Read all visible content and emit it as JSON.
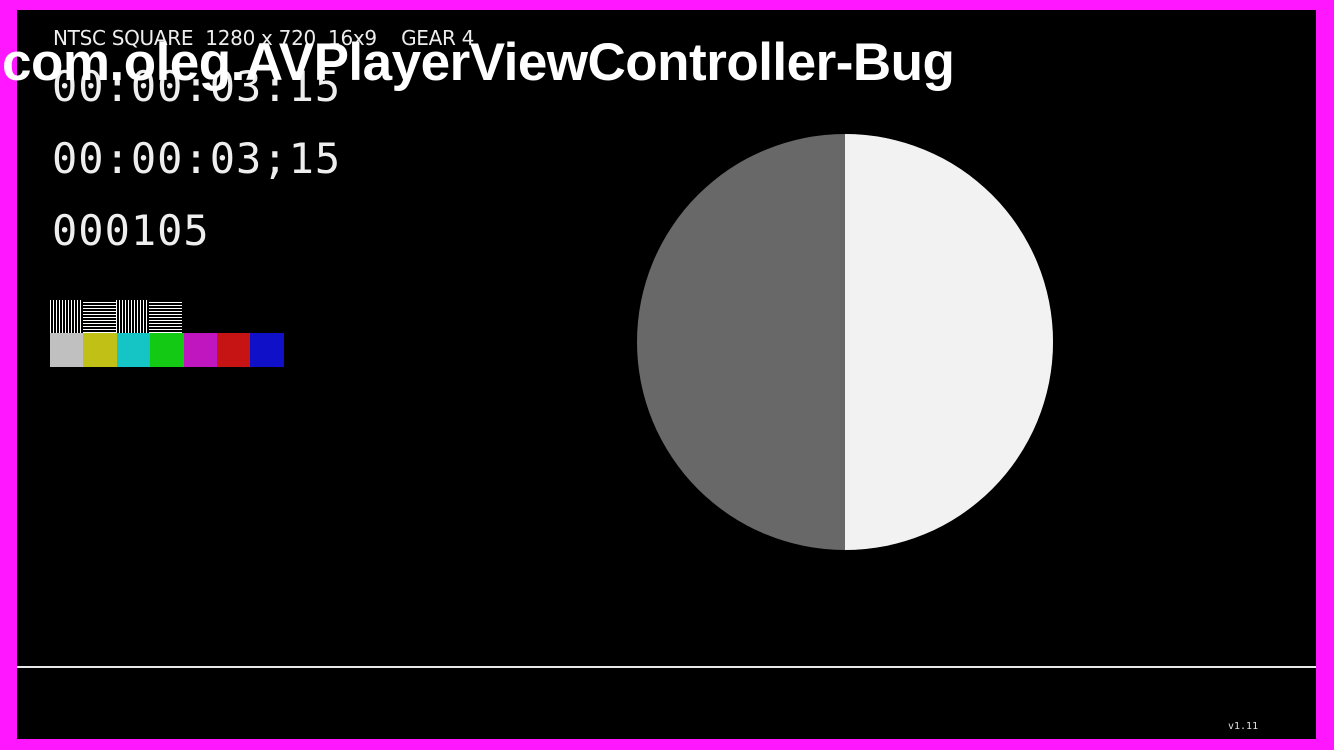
{
  "app": {
    "title": "com.oleg.AVPlayerViewController-Bug"
  },
  "video": {
    "info_line": "NTSC SQUARE  1280 x 720  16x9    GEAR 4",
    "timecode_1": "00:00:03:15",
    "timecode_2": "00:00:03;15",
    "frame_count": "000105",
    "version": "v1.11",
    "patterns": [
      "vertical-lines",
      "horizontal-lines",
      "vertical-lines",
      "horizontal-lines"
    ],
    "color_bars": [
      "#c0c0c0",
      "#c0c016",
      "#15c5c5",
      "#14c914",
      "#c016c0",
      "#c61414",
      "#1010c8"
    ],
    "clock_pie": {
      "filled_fraction": 0.5,
      "light_color": "#f2f2f2",
      "dark_color": "#686868"
    }
  },
  "colors": {
    "border": "#ff17ff",
    "background": "#000000"
  }
}
